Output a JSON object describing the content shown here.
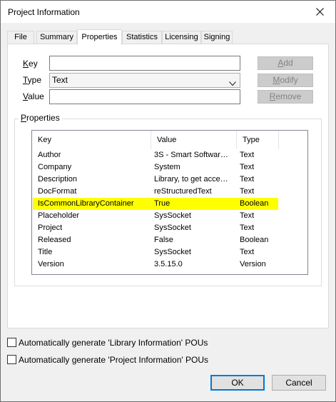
{
  "window": {
    "title": "Project Information"
  },
  "tabs": [
    "File",
    "Summary",
    "Properties",
    "Statistics",
    "Licensing",
    "Signing"
  ],
  "form": {
    "key_label_u": "K",
    "key_label_rest": "ey",
    "type_label_u": "T",
    "type_label_rest": "ype",
    "value_label_u": "V",
    "value_label_rest": "alue",
    "key_value": "",
    "type_value": "Text",
    "value_value": "",
    "add_label_u": "A",
    "add_label_rest": "dd",
    "modify_label_u": "M",
    "modify_label_rest": "odify",
    "remove_label_u": "R",
    "remove_label_rest": "emove"
  },
  "properties": {
    "group_title_u": "P",
    "group_title_rest": "roperties",
    "columns": [
      "Key",
      "Value",
      "Type"
    ],
    "rows": [
      [
        "Author",
        "3S - Smart Softwar…",
        "Text"
      ],
      [
        "Company",
        "System",
        "Text"
      ],
      [
        "Description",
        "Library, to get acce…",
        "Text"
      ],
      [
        "DocFormat",
        "reStructuredText",
        "Text"
      ],
      [
        "IsCommonLibraryContainer",
        "True",
        "Boolean"
      ],
      [
        "Placeholder",
        "SysSocket",
        "Text"
      ],
      [
        "Project",
        "SysSocket",
        "Text"
      ],
      [
        "Released",
        "False",
        "Boolean"
      ],
      [
        "Title",
        "SysSocket",
        "Text"
      ],
      [
        "Version",
        "3.5.15.0",
        "Version"
      ]
    ],
    "highlight_color": "#ffff00"
  },
  "options": {
    "gen_library_info": "Automatically generate 'Library Information' POUs",
    "gen_project_info": "Automatically generate 'Project Information' POUs"
  },
  "buttons": {
    "ok": "OK",
    "cancel": "Cancel"
  }
}
